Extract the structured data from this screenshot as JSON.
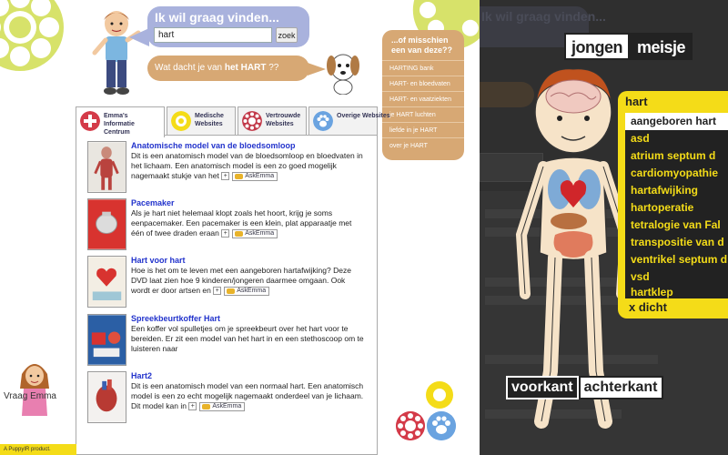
{
  "search": {
    "title": "Ik wil graag vinden...",
    "value": "hart",
    "button": "zoek"
  },
  "heart_question": {
    "prefix": "Wat dacht je van ",
    "bold": "het HART",
    "suffix": " ??"
  },
  "suggestions": {
    "title": "...of misschien een van deze??",
    "items": [
      "HARTING bank",
      "HART- en bloedvaten",
      "HART- en vaatziekten",
      "je HART luchten",
      "liefde in je HART",
      "over je HART"
    ]
  },
  "tabs": [
    {
      "label": "Emma's Informatie Centrum",
      "icon": "first-aid-icon",
      "color": "#d43b49"
    },
    {
      "label": "Medische Websites",
      "icon": "target-icon",
      "color": "#f4dc18"
    },
    {
      "label": "Vertrouwde Websites",
      "icon": "gear-icon",
      "color": "#c23a4a"
    },
    {
      "label": "Overige Websites",
      "icon": "paw-icon",
      "color": "#6aa3e0"
    }
  ],
  "results": [
    {
      "title": "Anatomische model van de bloedsomloop",
      "desc": "Dit is een anatomisch model van de bloedsomloop en bloedvaten in het lichaam. Een anatomisch model is een zo goed mogelijk nagemaakt stukje van het",
      "ask": "AskEmma"
    },
    {
      "title": "Pacemaker",
      "desc": "Als je hart niet helemaal klopt zoals het hoort, krijg je soms eenpacemaker. Een pacemaker is een klein, plat apparaatje met één of twee draden eraan",
      "ask": "AskEmma"
    },
    {
      "title": "Hart voor hart",
      "desc": "Hoe is het om te leven met een aangeboren hartafwijking? Deze DVD laat zien hoe 9 kinderen/jongeren daarmee omgaan. Ook wordt er door artsen en",
      "ask": "AskEmma"
    },
    {
      "title": "Spreekbeurtkoffer Hart",
      "desc": "Een koffer vol spulletjes om je spreekbeurt over het hart voor te bereiden. Er zit een model van het hart in en een stethoscoop om te luisteren naar",
      "ask": "AskEmma"
    },
    {
      "title": "Hart2",
      "desc": "Dit is een anatomisch model van een normaal hart. Een anatomisch model is een zo echt mogelijk nagemaakt onderdeel van je lichaam. Dit model kan in",
      "ask": "AskEmma"
    }
  ],
  "emma_label": "Vraag Emma",
  "footer": "A PuppyIR product.",
  "right": {
    "ghost_search": "Ik wil graag vinden...",
    "gender": {
      "boy": "jongen",
      "girl": "meisje"
    },
    "organ_list": {
      "head": "hart",
      "items": [
        "aangeboren hart",
        "asd",
        "atrium septum d",
        "cardiomyopathie",
        "hartafwijking",
        "hartoperatie",
        "tetralogie van Fal",
        "transpositie van d",
        "ventrikel septum d",
        "vsd",
        "hartklep"
      ],
      "close": "x dicht"
    },
    "view": {
      "front": "voorkant",
      "back": "achterkant"
    }
  },
  "colors": {
    "lavender": "#a9b2dd",
    "tan": "#d7a874",
    "yellow": "#f4dc18",
    "link_blue": "#2233cc",
    "overlay": "#2f2f2f"
  }
}
